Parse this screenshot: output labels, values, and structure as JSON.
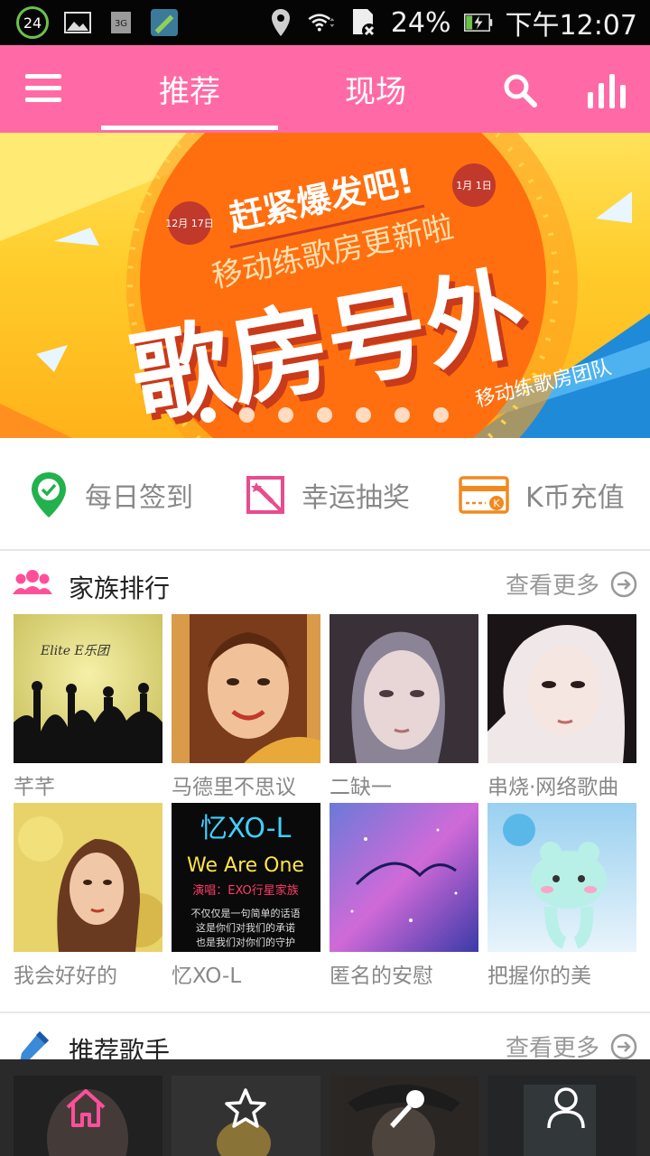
{
  "status_bar": {
    "notification_count": "24",
    "network": "3G",
    "battery": "24%",
    "time": "下午12:07",
    "icons": [
      "notification-count-icon",
      "image-icon",
      "network-3g-icon",
      "app-icon",
      "location-icon",
      "wifi-icon",
      "sd-card-icon",
      "battery-icon"
    ]
  },
  "header": {
    "tabs": [
      {
        "label": "推荐",
        "active": true
      },
      {
        "label": "现场",
        "active": false
      }
    ],
    "icons": [
      "menu-icon",
      "search-icon",
      "ranking-icon"
    ],
    "colors": {
      "brand": "#ff6aa6"
    }
  },
  "banner": {
    "headline": "赶紧爆发吧!",
    "subline": "移动练歌房更新啦",
    "big_text": "歌房号外",
    "team": "移动练歌房团队",
    "date_start": "12月 17日",
    "date_end": "1月 1日",
    "slide_count": 7,
    "active_slide": 1
  },
  "quick_actions": [
    {
      "label": "每日签到",
      "icon": "checkin-pin-icon"
    },
    {
      "label": "幸运抽奖",
      "icon": "lottery-icon"
    },
    {
      "label": "K币充值",
      "icon": "recharge-card-icon"
    }
  ],
  "family_ranking": {
    "title": "家族排行",
    "more": "查看更多",
    "items": [
      {
        "name": "芊芊"
      },
      {
        "name": "马德里不思议"
      },
      {
        "name": "二缺一"
      },
      {
        "name": "串烧·网络歌曲"
      },
      {
        "name": "我会好好的"
      },
      {
        "name": "忆XO-L"
      },
      {
        "name": "匿名的安慰"
      },
      {
        "name": "把握你的美"
      }
    ]
  },
  "thumbs": {
    "band_text": "Elite   E乐团",
    "poster_title": "忆XO-L",
    "poster_sub": "We Are One",
    "poster_credit": "演唱：EXO行星家族",
    "poster_lines": [
      "不仅仅是一句简单的话语",
      "这是你们对我们的承诺",
      "也是我们对你们的守护"
    ]
  },
  "recommended_singers": {
    "title": "推荐歌手",
    "more": "查看更多"
  },
  "bottom_nav": [
    {
      "name": "home",
      "icon": "home-icon",
      "active": true
    },
    {
      "name": "favorites",
      "icon": "star-icon",
      "active": false
    },
    {
      "name": "sing",
      "icon": "microphone-icon",
      "active": false
    },
    {
      "name": "profile",
      "icon": "user-icon",
      "active": false
    }
  ]
}
